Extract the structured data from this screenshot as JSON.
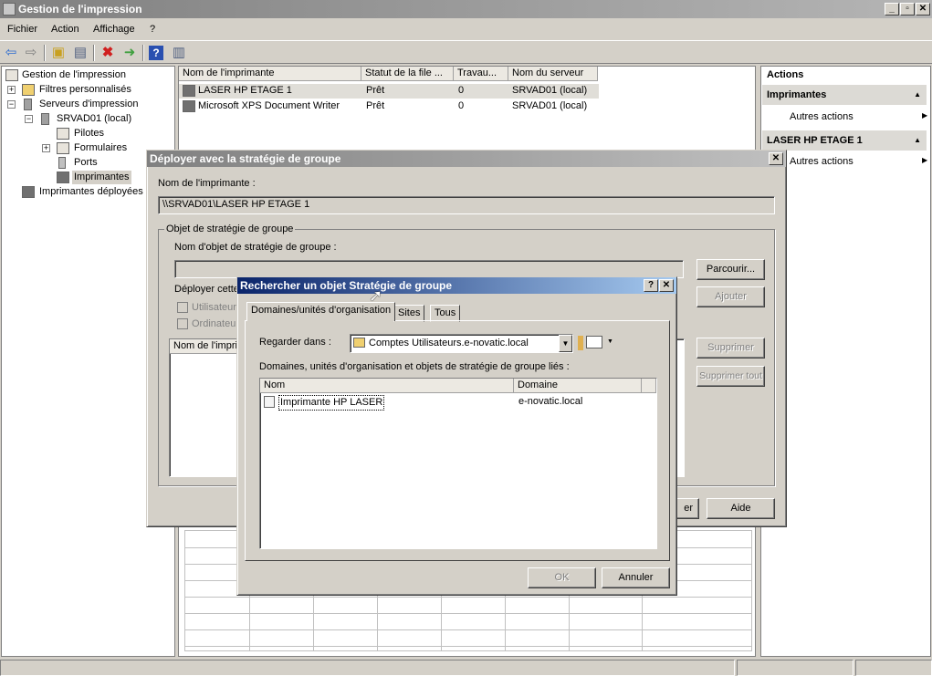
{
  "window": {
    "title": "Gestion de l'impression"
  },
  "menu": [
    "Fichier",
    "Action",
    "Affichage",
    "?"
  ],
  "tree": {
    "root": "Gestion de l'impression",
    "custom_filters": "Filtres personnalisés",
    "print_servers": "Serveurs d'impression",
    "server": "SRVAD01 (local)",
    "drivers": "Pilotes",
    "forms": "Formulaires",
    "ports": "Ports",
    "printers": "Imprimantes",
    "deployed": "Imprimantes déployées"
  },
  "list": {
    "columns": [
      "Nom de l'imprimante",
      "Statut de la file ...",
      "Travau...",
      "Nom du serveur"
    ],
    "rows": [
      [
        "LASER HP ETAGE 1",
        "Prêt",
        "0",
        "SRVAD01 (local)"
      ],
      [
        "Microsoft XPS Document Writer",
        "Prêt",
        "0",
        "SRVAD01 (local)"
      ]
    ]
  },
  "actions": {
    "title": "Actions",
    "section1": "Imprimantes",
    "section1_item": "Autres actions",
    "section2": "LASER HP ETAGE 1",
    "section2_item": "Autres actions"
  },
  "deploy_dialog": {
    "title": "Déployer avec la stratégie de groupe",
    "printer_name_label": "Nom de l'imprimante :",
    "printer_name_value": "\\\\SRVAD01\\LASER HP ETAGE 1",
    "group_title": "Objet de stratégie de groupe",
    "gpo_name_label": "Nom d'objet de stratégie de groupe :",
    "browse": "Parcourir...",
    "deploy_label": "Déployer cette",
    "users_label": "Utilisateur",
    "computers_label": "Ordinateur",
    "add": "Ajouter",
    "list_column": "Nom de l'impri",
    "remove": "Supprimer",
    "remove_all": "Supprimer tout",
    "ok_partial": "er",
    "help": "Aide"
  },
  "gpo_dialog": {
    "title": "Rechercher un objet Stratégie de groupe",
    "help_btn": "?",
    "close_btn": "✕",
    "tabs": [
      "Domaines/unités d'organisation",
      "Sites",
      "Tous"
    ],
    "look_in_label": "Regarder dans :",
    "look_in_value": "Comptes Utilisateurs.e-novatic.local",
    "linked_label": "Domaines, unités d'organisation et objets de stratégie de groupe liés :",
    "columns": [
      "Nom",
      "Domaine"
    ],
    "rows": [
      {
        "name": "Imprimante HP LASER",
        "domain": "e-novatic.local"
      }
    ],
    "ok": "OK",
    "cancel": "Annuler"
  }
}
